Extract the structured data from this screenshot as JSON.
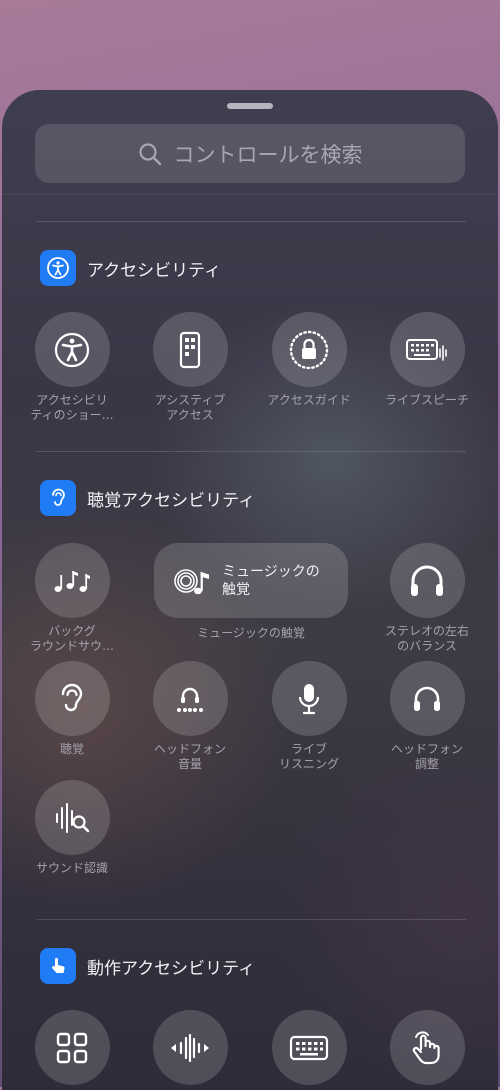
{
  "search": {
    "placeholder": "コントロールを検索"
  },
  "sections": [
    {
      "title": "アクセシビリティ",
      "icon": "accessibility-icon",
      "controls": [
        {
          "label": "アクセシビリ\nティのショー…",
          "icon": "accessibility-person-icon"
        },
        {
          "label": "アシスティブ\nアクセス",
          "icon": "assistive-access-phone-icon"
        },
        {
          "label": "アクセスガイド",
          "icon": "guided-access-lock-icon"
        },
        {
          "label": "ライブスピーチ",
          "icon": "keyboard-waveform-icon"
        }
      ]
    },
    {
      "title": "聴覚アクセシビリティ",
      "icon": "ear-icon",
      "controls": [
        {
          "label": "バックグ\nラウンドサウ…",
          "icon": "music-notes-icon"
        },
        {
          "label": "ミュージックの\n触覚",
          "sublabel": "ミュージックの触覚",
          "icon": "music-haptics-icon"
        },
        {
          "label": "ステレオの左右\nのバランス",
          "icon": "headphones-icon"
        },
        {
          "label": "聴覚",
          "icon": "ear-icon"
        },
        {
          "label": "ヘッドフォン\n音量",
          "icon": "headphone-level-icon"
        },
        {
          "label": "ライブ\nリスニング",
          "icon": "microphone-icon"
        },
        {
          "label": "ヘッドフォン\n調整",
          "icon": "headphones-adjust-icon"
        },
        {
          "label": "サウンド認識",
          "icon": "sound-recognition-icon"
        }
      ]
    },
    {
      "title": "動作アクセシビリティ",
      "icon": "hand-pointer-icon",
      "controls": [
        {
          "label": "",
          "icon": "grid-icon"
        },
        {
          "label": "",
          "icon": "waveform-arrows-icon"
        },
        {
          "label": "",
          "icon": "keyboard-icon"
        },
        {
          "label": "",
          "icon": "hand-tap-icon"
        }
      ]
    }
  ],
  "colors": {
    "accent": "#1f7cf5"
  }
}
